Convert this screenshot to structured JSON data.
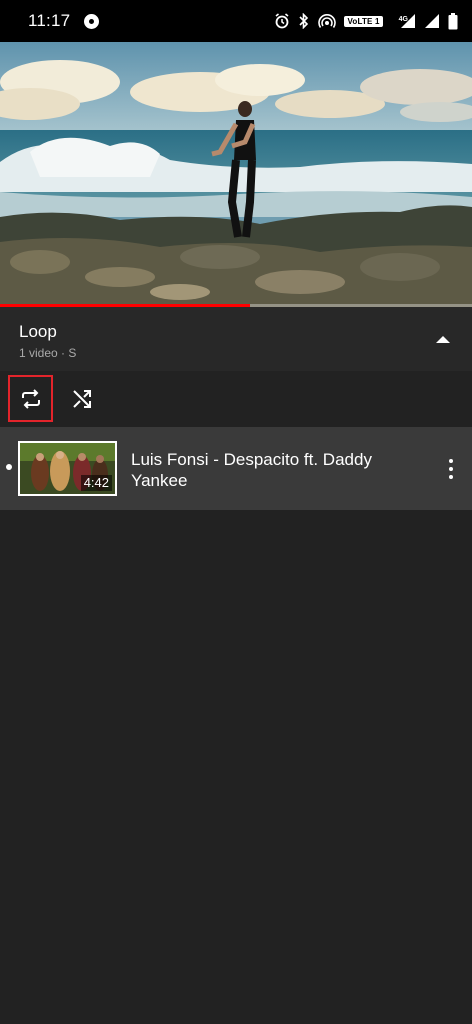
{
  "status_bar": {
    "time": "11:17",
    "volte_label": "VoLTE 1",
    "network_label": "4G",
    "icons": [
      "screen-record-icon",
      "alarm-icon",
      "bluetooth-icon",
      "hotspot-icon",
      "volte-icon",
      "signal-icon",
      "signal-2-icon",
      "battery-icon"
    ]
  },
  "video": {
    "progress": 0.53,
    "accent_color": "#ff0000"
  },
  "playlist": {
    "title": "Loop",
    "subtitle": "1 video · S",
    "collapse_icon": "chevron-up-icon"
  },
  "controls": {
    "loop_icon": "repeat-icon",
    "shuffle_icon": "shuffle-icon",
    "highlight_color": "#e3242b"
  },
  "items": [
    {
      "title": "Luis Fonsi - Despacito ft. Daddy Yankee",
      "duration": "4:42",
      "now_playing": true
    }
  ]
}
